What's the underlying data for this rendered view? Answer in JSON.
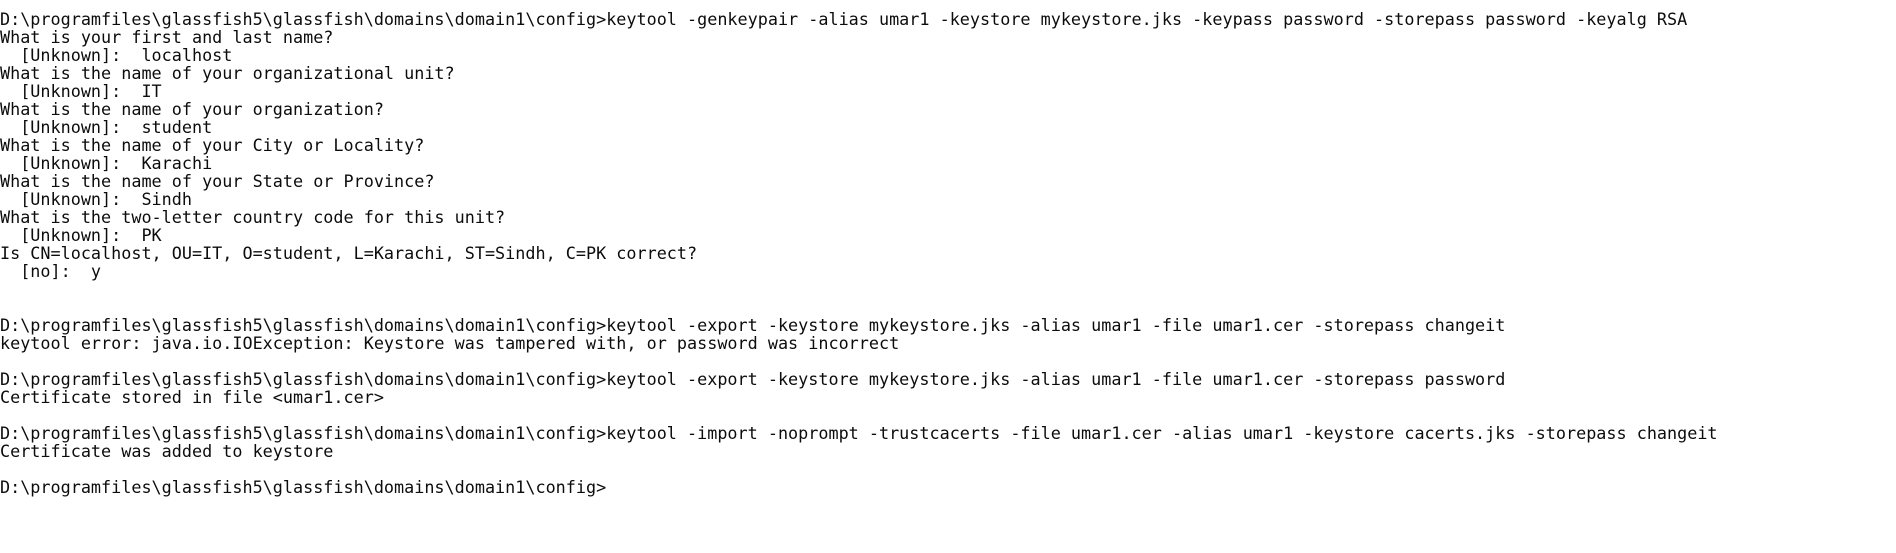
{
  "terminal": {
    "lines": [
      "D:\\programfiles\\glassfish5\\glassfish\\domains\\domain1\\config>keytool -genkeypair -alias umar1 -keystore mykeystore.jks -keypass password -storepass password -keyalg RSA",
      "What is your first and last name?",
      "  [Unknown]:  localhost",
      "What is the name of your organizational unit?",
      "  [Unknown]:  IT",
      "What is the name of your organization?",
      "  [Unknown]:  student",
      "What is the name of your City or Locality?",
      "  [Unknown]:  Karachi",
      "What is the name of your State or Province?",
      "  [Unknown]:  Sindh",
      "What is the two-letter country code for this unit?",
      "  [Unknown]:  PK",
      "Is CN=localhost, OU=IT, O=student, L=Karachi, ST=Sindh, C=PK correct?",
      "  [no]:  y",
      "",
      "",
      "D:\\programfiles\\glassfish5\\glassfish\\domains\\domain1\\config>keytool -export -keystore mykeystore.jks -alias umar1 -file umar1.cer -storepass changeit",
      "keytool error: java.io.IOException: Keystore was tampered with, or password was incorrect",
      "",
      "D:\\programfiles\\glassfish5\\glassfish\\domains\\domain1\\config>keytool -export -keystore mykeystore.jks -alias umar1 -file umar1.cer -storepass password",
      "Certificate stored in file <umar1.cer>",
      "",
      "D:\\programfiles\\glassfish5\\glassfish\\domains\\domain1\\config>keytool -import -noprompt -trustcacerts -file umar1.cer -alias umar1 -keystore cacerts.jks -storepass changeit",
      "Certificate was added to keystore",
      "",
      "D:\\programfiles\\glassfish5\\glassfish\\domains\\domain1\\config>"
    ]
  }
}
